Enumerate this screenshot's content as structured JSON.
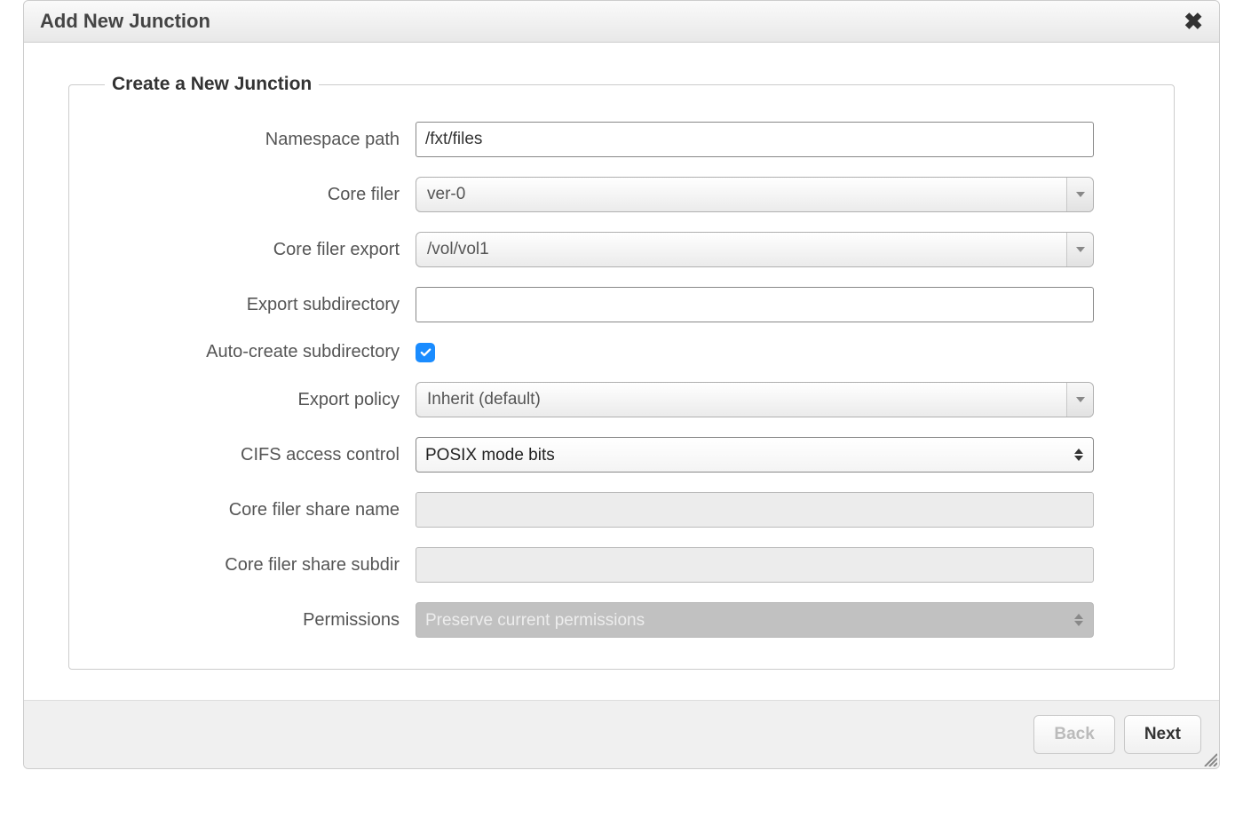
{
  "dialog": {
    "title": "Add New Junction"
  },
  "fieldset": {
    "legend": "Create a New Junction"
  },
  "labels": {
    "namespace_path": "Namespace path",
    "core_filer": "Core filer",
    "core_filer_export": "Core filer export",
    "export_subdirectory": "Export subdirectory",
    "auto_create_subdirectory": "Auto-create subdirectory",
    "export_policy": "Export policy",
    "cifs_access_control": "CIFS access control",
    "core_filer_share_name": "Core filer share name",
    "core_filer_share_subdir": "Core filer share subdir",
    "permissions": "Permissions"
  },
  "values": {
    "namespace_path": "/fxt/files",
    "core_filer": "ver-0",
    "core_filer_export": "/vol/vol1",
    "export_subdirectory": "",
    "auto_create_subdirectory": true,
    "export_policy": "Inherit (default)",
    "cifs_access_control": "POSIX mode bits",
    "core_filer_share_name": "",
    "core_filer_share_subdir": "",
    "permissions": "Preserve current permissions"
  },
  "footer": {
    "back_label": "Back",
    "next_label": "Next"
  }
}
